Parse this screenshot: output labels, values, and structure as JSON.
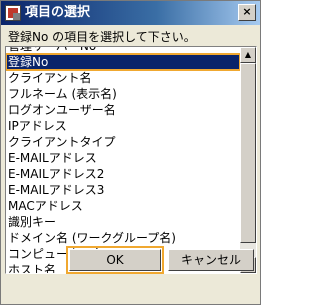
{
  "window": {
    "title": "項目の選択",
    "close_label": "×"
  },
  "instruction": "登録No の項目を選択して下さい。",
  "list": {
    "items": [
      {
        "label": "管理サーバーNo",
        "selected": false
      },
      {
        "label": "登録No",
        "selected": true
      },
      {
        "label": "クライアント名",
        "selected": false
      },
      {
        "label": "フルネーム (表示名)",
        "selected": false
      },
      {
        "label": "ログオンユーザー名",
        "selected": false
      },
      {
        "label": "IPアドレス",
        "selected": false
      },
      {
        "label": "クライアントタイプ",
        "selected": false
      },
      {
        "label": "E-MAILアドレス",
        "selected": false
      },
      {
        "label": "E-MAILアドレス2",
        "selected": false
      },
      {
        "label": "E-MAILアドレス3",
        "selected": false
      },
      {
        "label": "MACアドレス",
        "selected": false
      },
      {
        "label": "識別キー",
        "selected": false
      },
      {
        "label": "ドメイン名 (ワークグループ名)",
        "selected": false
      },
      {
        "label": "コンピューター名",
        "selected": false
      },
      {
        "label": "ホスト名",
        "selected": false
      }
    ]
  },
  "scrollbar": {
    "up_glyph": "▲",
    "down_glyph": "▼"
  },
  "buttons": {
    "ok": "OK",
    "cancel": "キャンセル"
  },
  "colors": {
    "selection": "#0a246a",
    "focus_highlight": "#f0a830",
    "titlebar_start": "#0a246a"
  }
}
